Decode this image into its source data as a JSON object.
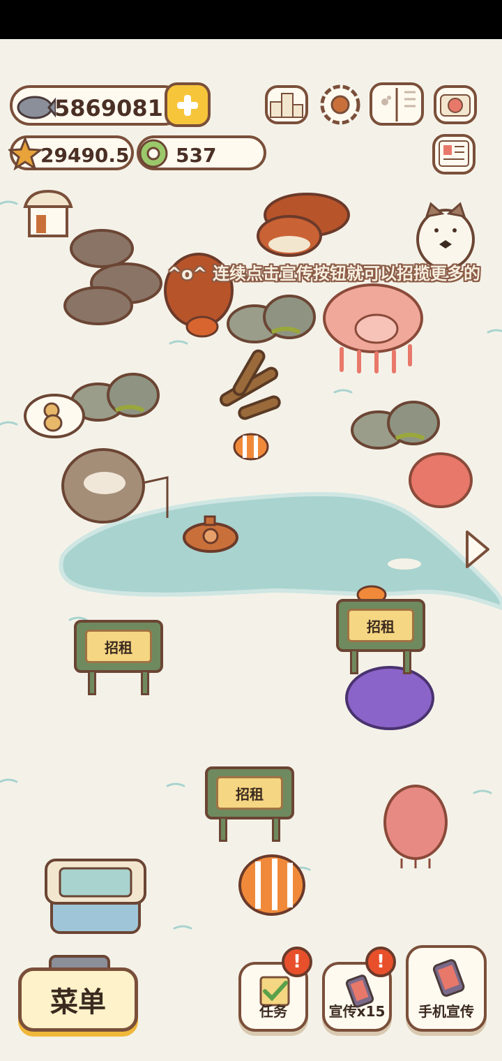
{
  "hud": {
    "fish_count": "5869081",
    "star_count": "29490.5",
    "ring_count": "537"
  },
  "top_icons": [
    "ranking-icon",
    "settings-gear-icon",
    "paw-book-icon",
    "camera-icon",
    "news-card-icon",
    "shop-icon"
  ],
  "marquee_text": "^o^ 连续点击宣传按钮就可以招揽更多的",
  "signs": [
    "招租",
    "招租",
    "招租"
  ],
  "menu_label": "菜单",
  "bottom_buttons": {
    "tasks_label": "任务",
    "promote_label": "宣传x15",
    "phone_promote_label": "手机宣传",
    "alert_mark": "!"
  },
  "colors": {
    "background": "#f4f2e8",
    "outline": "#7a4f3a",
    "pond": "#a9d3cf",
    "alert": "#e8502c",
    "sign_green": "#6f8a5e",
    "plaque": "#f5d682"
  }
}
